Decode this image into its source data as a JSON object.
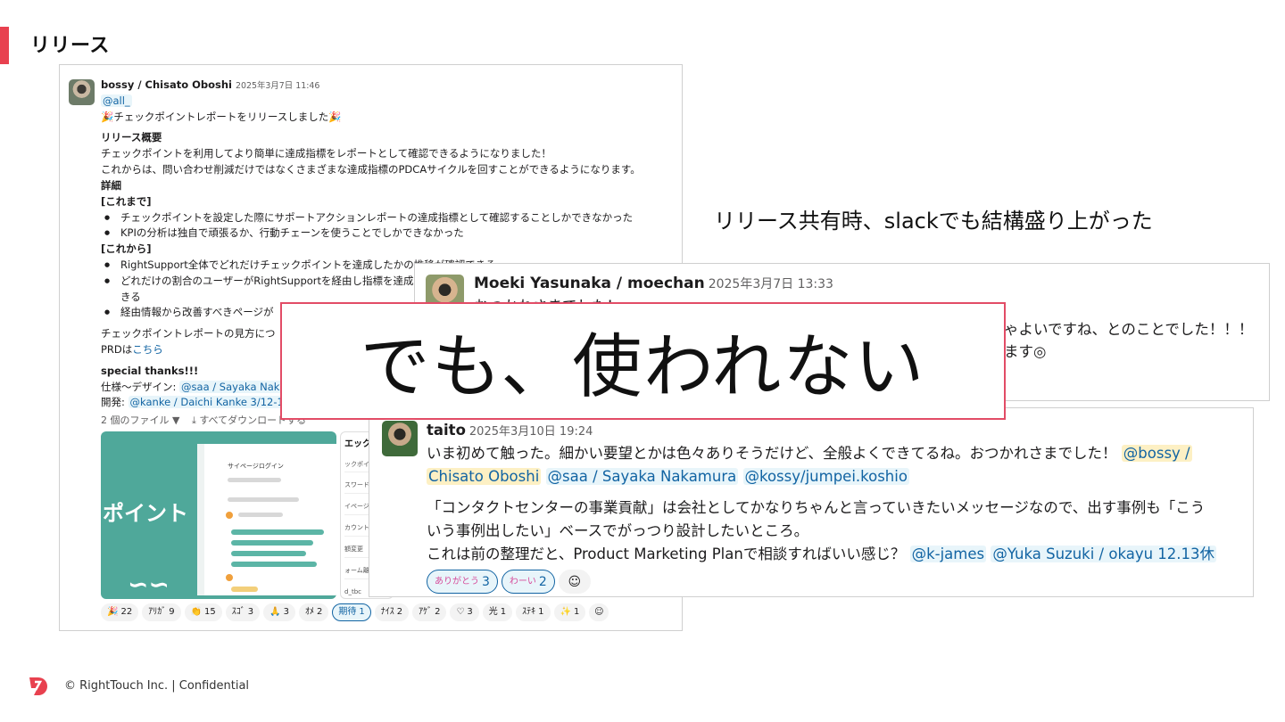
{
  "slide": {
    "title": "リリース",
    "side_note": "リリース共有時、slackでも結構盛り上がった",
    "overlay_text": "でも、使われない",
    "footer": "© RightTouch Inc.  |  Confidential",
    "accent_color": "#e8414f"
  },
  "post1": {
    "author": "bossy / Chisato Oboshi",
    "timestamp": "2025年3月7日 11:46",
    "mention_all": "@all_",
    "headline": "チェックポイントレポートをリリースしました",
    "headline_emoji": "🎉",
    "summary_heading": "リリース概要",
    "summary_line1": "チェックポイントを利用してより簡単に達成指標をレポートとして確認できるようになりました！",
    "summary_line2": "これからは、問い合わせ削減だけではなくさまざまな達成指標のPDCAサイクルを回すことができるようになります。",
    "details_heading": "詳細",
    "before_heading": "[これまで]",
    "before_items": [
      "チェックポイントを設定した際にサポートアクションレポートの達成指標として確認することしかできなかった",
      "KPIの分析は独自で頑張るか、行動チェーンを使うことでしかできなかった"
    ],
    "after_heading": "[これから]",
    "after_items": [
      "RightSupport全体でどれだけチェックポイントを達成したかの推移が確認できる",
      "どれだけの割合のユーザーがRightSupportを経由し指標を達成",
      "きる",
      "経由情報から改善すべきページが"
    ],
    "guide_line": "チェックポイントレポートの見方につ",
    "prd_prefix": "PRDは",
    "prd_link": "こちら",
    "thanks_heading": "special thanks!!!",
    "spec_label": "仕様〜デザイン: ",
    "spec_mention": "@saa / Sayaka Naka",
    "dev_label": "開発: ",
    "dev_mention": "@kanke / Daichi Kanke 3/12-13",
    "files_label": "2 個のファイル ▼",
    "download_label": "すべてダウンロードする",
    "preview1_word": "ポイント",
    "preview1_heading": "サイページログイン",
    "preview2_heading": "エックポ",
    "preview2_rows": [
      "ックポイント名",
      "スワード変更",
      "イページログイ",
      "カウント削除",
      "額変更",
      "ォーム離脱",
      "d_tbc"
    ],
    "reactions": [
      {
        "emoji": "🎉",
        "count": "22",
        "active": false
      },
      {
        "emoji": "ｱﾘｶﾞ",
        "count": "9",
        "active": false
      },
      {
        "emoji": "👏",
        "count": "15",
        "active": false
      },
      {
        "emoji": "ｽｺﾞ",
        "count": "3",
        "active": false
      },
      {
        "emoji": "🙏",
        "count": "3",
        "active": false
      },
      {
        "emoji": "ｵﾒ",
        "count": "2",
        "active": false
      },
      {
        "emoji": "期待",
        "count": "1",
        "active": true
      },
      {
        "emoji": "ﾅｲｽ",
        "count": "2",
        "active": false
      },
      {
        "emoji": "ｱｹﾞ",
        "count": "2",
        "active": false
      },
      {
        "emoji": "♡",
        "count": "3",
        "active": false
      },
      {
        "emoji": "光",
        "count": "1",
        "active": false
      },
      {
        "emoji": "ｽﾃｷ",
        "count": "1",
        "active": false
      },
      {
        "emoji": "✨",
        "count": "1",
        "active": false
      }
    ]
  },
  "post2": {
    "author": "Moeki Yasunaka / moechan",
    "timestamp": "2025年3月7日 13:33",
    "line1_partial": "おつかれさまでした！",
    "line2_partial": "ゃよいですね、とのことでした！！！",
    "line3_partial": "ます◎"
  },
  "post3": {
    "author": "taito",
    "timestamp": "2025年3月10日 19:24",
    "para1": "いま初めて触った。細かい要望とかは色々ありそうだけど、全般よくできてるね。おつかれさまでした！",
    "mention1a": "@bossy /",
    "mention1b": "Chisato Oboshi",
    "mention2": "@saa / Sayaka Nakamura",
    "mention3": "@kossy/jumpei.koshio",
    "para2_line1": "「コンタクトセンターの事業貢献」は会社としてかなりちゃんと言っていきたいメッセージなので、出す事例も「こう",
    "para2_line2": "いう事例出したい」ベースでがっつり設計したいところ。",
    "para3": "これは前の整理だと、Product Marketing Planで相談すればいい感じ？",
    "mention4": "@k-james",
    "mention5": "@Yuka Suzuki / okayu 12.13休",
    "reactions": [
      {
        "emoji": "ありがとう",
        "count": "3"
      },
      {
        "emoji": "わーい",
        "count": "2"
      }
    ]
  }
}
